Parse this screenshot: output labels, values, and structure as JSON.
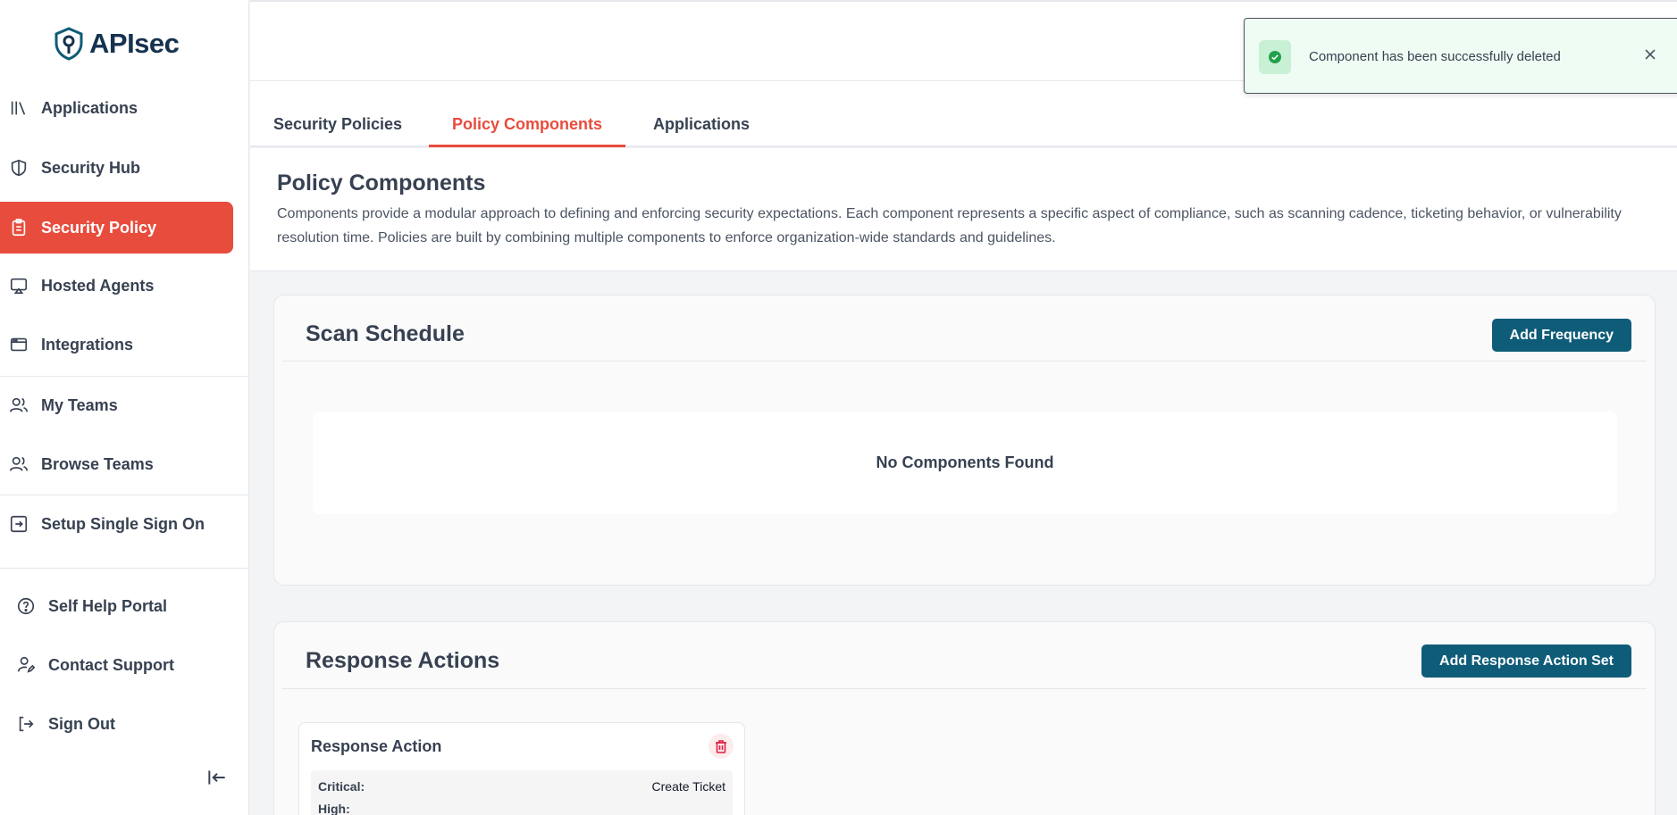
{
  "brand": {
    "name": "APIsec"
  },
  "sidebar": {
    "items": [
      {
        "label": "Applications",
        "icon": "library-icon"
      },
      {
        "label": "Security Hub",
        "icon": "shield-icon"
      },
      {
        "label": "Security Policy",
        "icon": "clipboard-icon",
        "active": true
      },
      {
        "label": "Hosted Agents",
        "icon": "monitor-icon"
      },
      {
        "label": "Integrations",
        "icon": "browser-window-icon"
      },
      {
        "label": "My Teams",
        "icon": "users-icon"
      },
      {
        "label": "Browse Teams",
        "icon": "users-icon"
      },
      {
        "label": "Setup Single Sign On",
        "icon": "sign-in-icon"
      }
    ],
    "footer": [
      {
        "label": "Self Help Portal",
        "icon": "help-circle-icon"
      },
      {
        "label": "Contact Support",
        "icon": "user-pen-icon"
      },
      {
        "label": "Sign Out",
        "icon": "log-out-icon"
      }
    ]
  },
  "tabs": [
    {
      "label": "Security Policies"
    },
    {
      "label": "Policy Components",
      "active": true
    },
    {
      "label": "Applications"
    }
  ],
  "page": {
    "title": "Policy Components",
    "description": "Components provide a modular approach to defining and enforcing security expectations. Each component represents a specific aspect of compliance, such as scanning cadence, ticketing behavior, or vulnerability resolution time. Policies are built by combining multiple components to enforce organization-wide standards and guidelines."
  },
  "scan_schedule": {
    "title": "Scan Schedule",
    "button": "Add Frequency",
    "empty": "No Components Found"
  },
  "response_actions": {
    "title": "Response Actions",
    "button": "Add Response Action Set",
    "card": {
      "title": "Response Action",
      "rows": [
        {
          "key": "Critical:",
          "value": "Create Ticket"
        },
        {
          "key": "High:",
          "value": ""
        }
      ]
    }
  },
  "toast": {
    "message": "Component has been successfully deleted"
  },
  "colors": {
    "accent": "#e84c3d",
    "primary_button": "#0f5c78",
    "brand": "#16324f",
    "toast_bg": "#effcf3",
    "success": "#22a04b"
  }
}
